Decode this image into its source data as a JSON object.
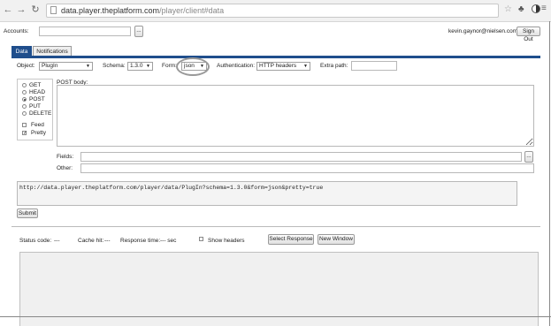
{
  "browser": {
    "url_host": "data.player.theplatform.com",
    "url_path": "/player/client#data",
    "back_icon": "arrow-left-icon",
    "forward_icon": "arrow-right-icon",
    "reload_icon": "reload-icon"
  },
  "header": {
    "accounts_label": "Accounts:",
    "accounts_value": "",
    "accounts_button": "...",
    "user_email": "kevin.gaynor@nielsen.com",
    "signout_label": "Sign Out"
  },
  "tabs": [
    {
      "label": "Data"
    },
    {
      "label": "Notifications"
    }
  ],
  "options": {
    "object_label": "Object:",
    "object_value": "PlugIn",
    "schema_label": "Schema:",
    "schema_value": "1.3.0",
    "form_label": "Form:",
    "form_value": "json",
    "auth_label": "Authentication:",
    "auth_value": "HTTP headers",
    "extra_path_label": "Extra path:",
    "extra_path_value": ""
  },
  "methods": [
    {
      "label": "GET",
      "selected": false
    },
    {
      "label": "HEAD",
      "selected": false
    },
    {
      "label": "POST",
      "selected": true
    },
    {
      "label": "PUT",
      "selected": false
    },
    {
      "label": "DELETE",
      "selected": false
    }
  ],
  "flags": [
    {
      "label": "Feed",
      "checked": false
    },
    {
      "label": "Pretty",
      "checked": true
    }
  ],
  "body": {
    "post_body_label": "POST body:",
    "post_body_value": "",
    "fields_label": "Fields:",
    "fields_value": "",
    "fields_button": "...",
    "other_label": "Other:",
    "other_value": ""
  },
  "request_url": "http://data.player.theplatform.com/player/data/PlugIn?schema=1.3.0&form=json&pretty=true",
  "submit_label": "Submit",
  "response": {
    "status_label": "Status code:",
    "status_value": "---",
    "cache_label": "Cache hit:",
    "cache_value": "---",
    "time_label": "Response time:",
    "time_value": "--- sec",
    "show_headers_label": "Show headers",
    "show_headers_checked": false,
    "select_response_label": "Select Response",
    "new_window_label": "New Window",
    "output": ""
  }
}
